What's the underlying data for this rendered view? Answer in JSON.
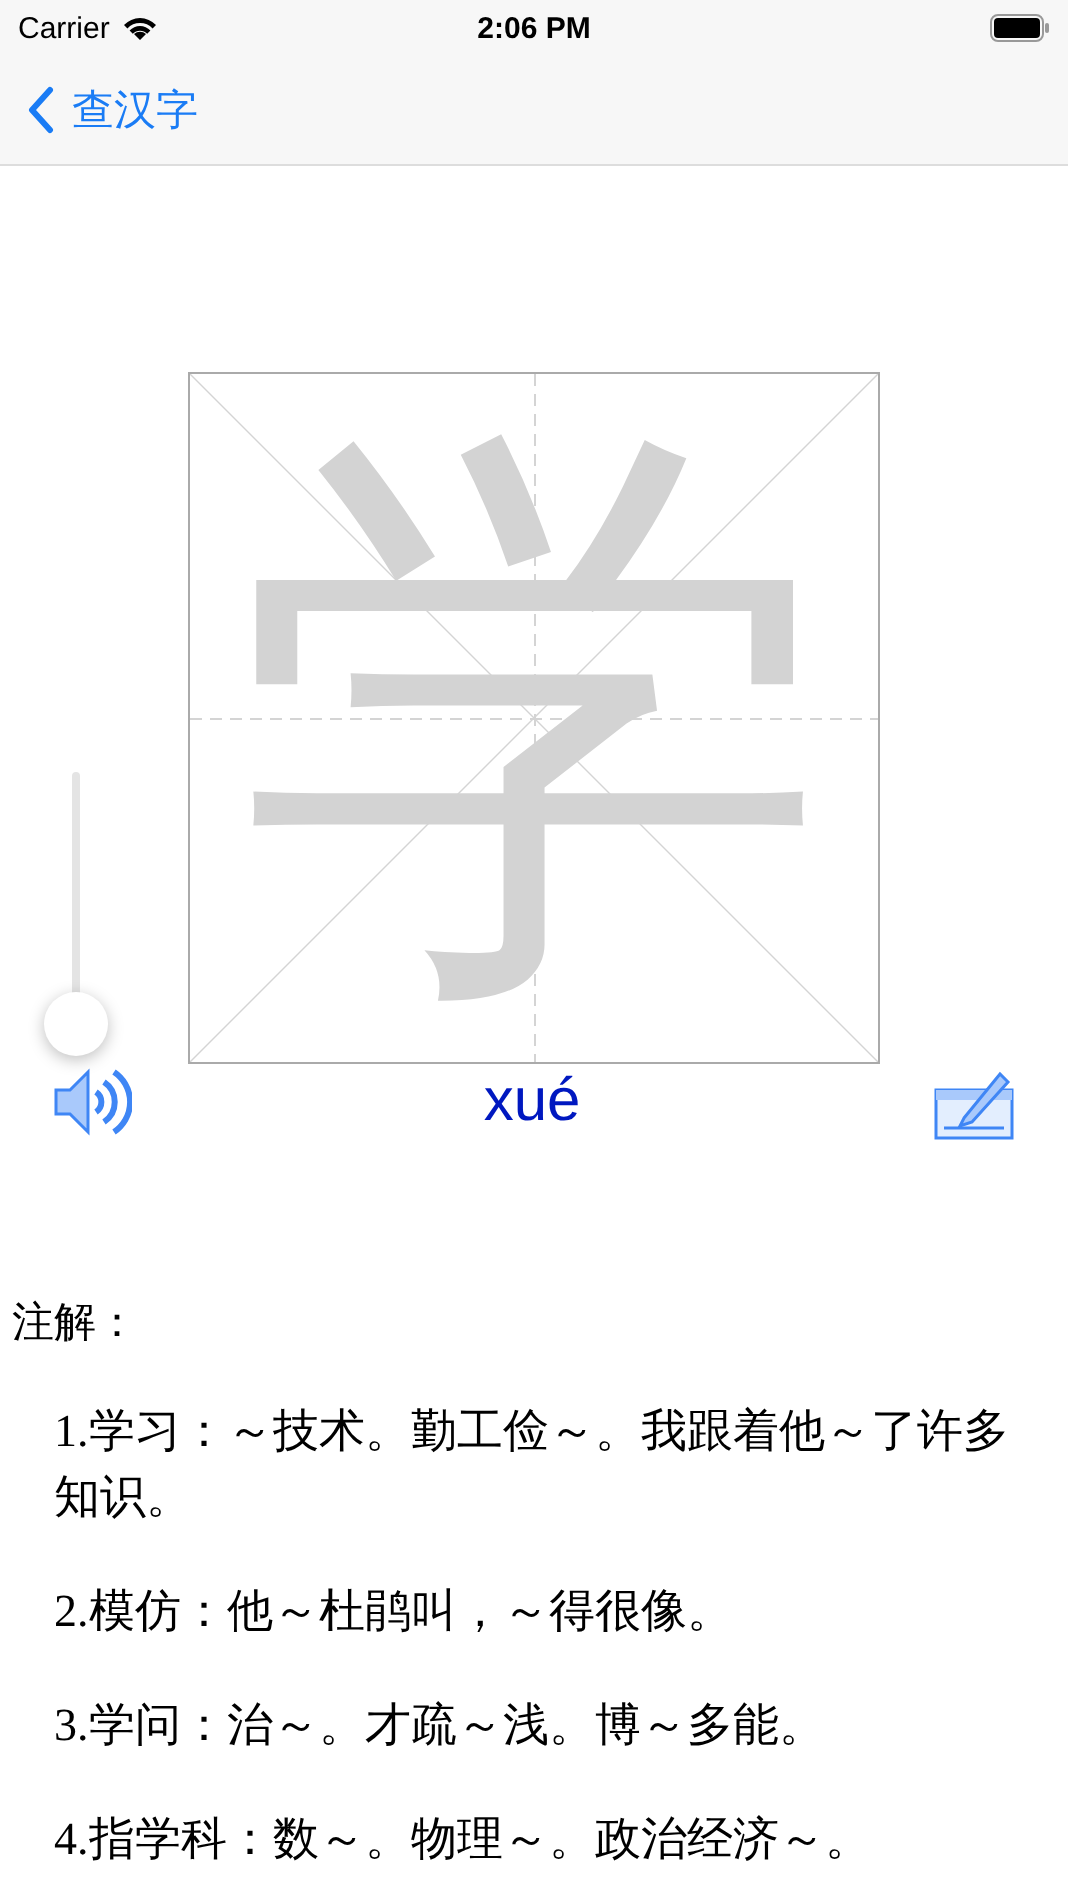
{
  "status_bar": {
    "carrier": "Carrier",
    "time": "2:06 PM"
  },
  "nav": {
    "back_label": "查汉字"
  },
  "character": {
    "glyph": "学",
    "pinyin": "xué"
  },
  "speed_slider": {
    "level": 0.1
  },
  "notes": {
    "heading": "注解：",
    "items": [
      "1.学习：～技术。勤工俭～。我跟着他～了许多知识。",
      "2.模仿：他～杜鹃叫，～得很像。",
      "3.学问：治～。才疏～浅。博～多能。",
      "4.指学科：数～。物理～。政治经济～。"
    ]
  }
}
